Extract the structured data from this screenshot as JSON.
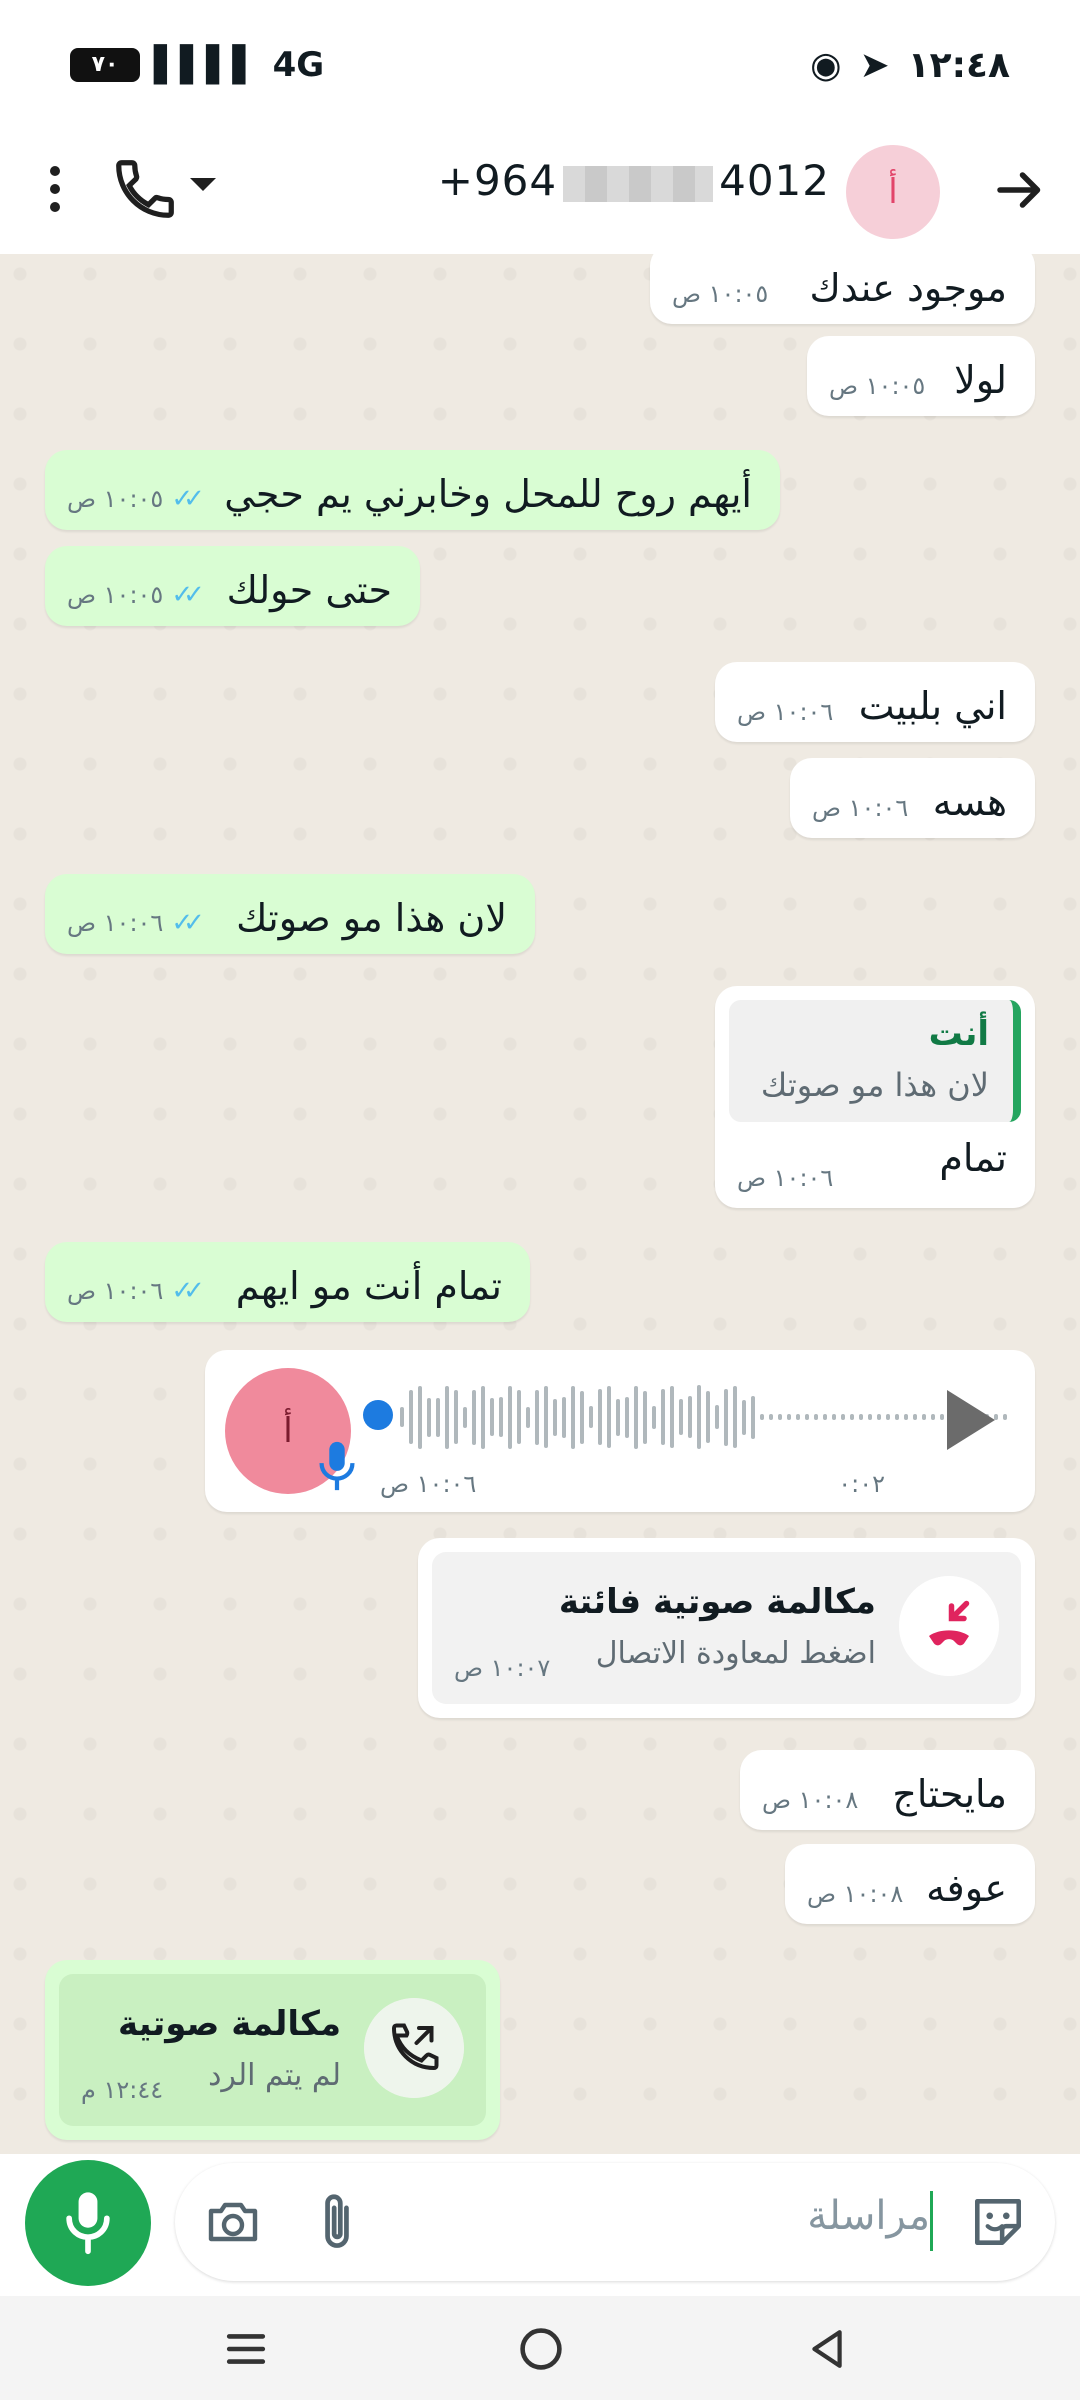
{
  "status_bar": {
    "battery": "٧٠",
    "network": "4G",
    "time": "١٢:٤٨"
  },
  "header": {
    "phone_prefix": "+964",
    "phone_suffix": "4012",
    "avatar_letter": "أ"
  },
  "messages": [
    {
      "id": "m1",
      "dir": "in",
      "text": "موجود عندك",
      "time": "١٠:٠٥ ص"
    },
    {
      "id": "m2",
      "dir": "in",
      "text": "لولا",
      "time": "١٠:٠٥ ص"
    },
    {
      "id": "m3",
      "dir": "out",
      "text": "أيهم روح للمحل وخابرني يم حجي",
      "time": "١٠:٠٥ ص"
    },
    {
      "id": "m4",
      "dir": "out",
      "text": "حتى حولك",
      "time": "١٠:٠٥ ص"
    },
    {
      "id": "m5",
      "dir": "in",
      "text": "اني بلبيت",
      "time": "١٠:٠٦ ص"
    },
    {
      "id": "m6",
      "dir": "in",
      "text": "هسه",
      "time": "١٠:٠٦ ص"
    },
    {
      "id": "m7",
      "dir": "out",
      "text": "لان هذا مو صوتك",
      "time": "١٠:٠٦ ص"
    },
    {
      "id": "m8",
      "dir": "in",
      "text": "تمام",
      "time": "١٠:٠٦ ص",
      "quote_name": "أنت",
      "quote_text": "لان هذا مو صوتك"
    },
    {
      "id": "m9",
      "dir": "out",
      "text": "تمام أنت مو ايهم",
      "time": "١٠:٠٦ ص"
    }
  ],
  "voice_message": {
    "avatar_letter": "أ",
    "duration": "٠:٠٢",
    "time": "١٠:٠٦ ص"
  },
  "missed_call": {
    "title": "مكالمة صوتية فائتة",
    "subtitle": "اضغط لمعاودة الاتصال",
    "time": "١٠:٠٧ ص"
  },
  "messages2": [
    {
      "id": "m10",
      "dir": "in",
      "text": "مايحتاج",
      "time": "١٠:٠٨ ص"
    },
    {
      "id": "m11",
      "dir": "in",
      "text": "عوفه",
      "time": "١٠:٠٨ ص"
    }
  ],
  "outgoing_call": {
    "title": "مكالمة صوتية",
    "subtitle": "لم يتم الرد",
    "time": "١٢:٤٤ م"
  },
  "composer": {
    "placeholder": "مراسلة"
  },
  "colors": {
    "accent": "#1fa855",
    "outgoing_bubble": "#d9fdd3",
    "missed_call": "#e0245e",
    "read_ticks": "#53bdeb"
  }
}
